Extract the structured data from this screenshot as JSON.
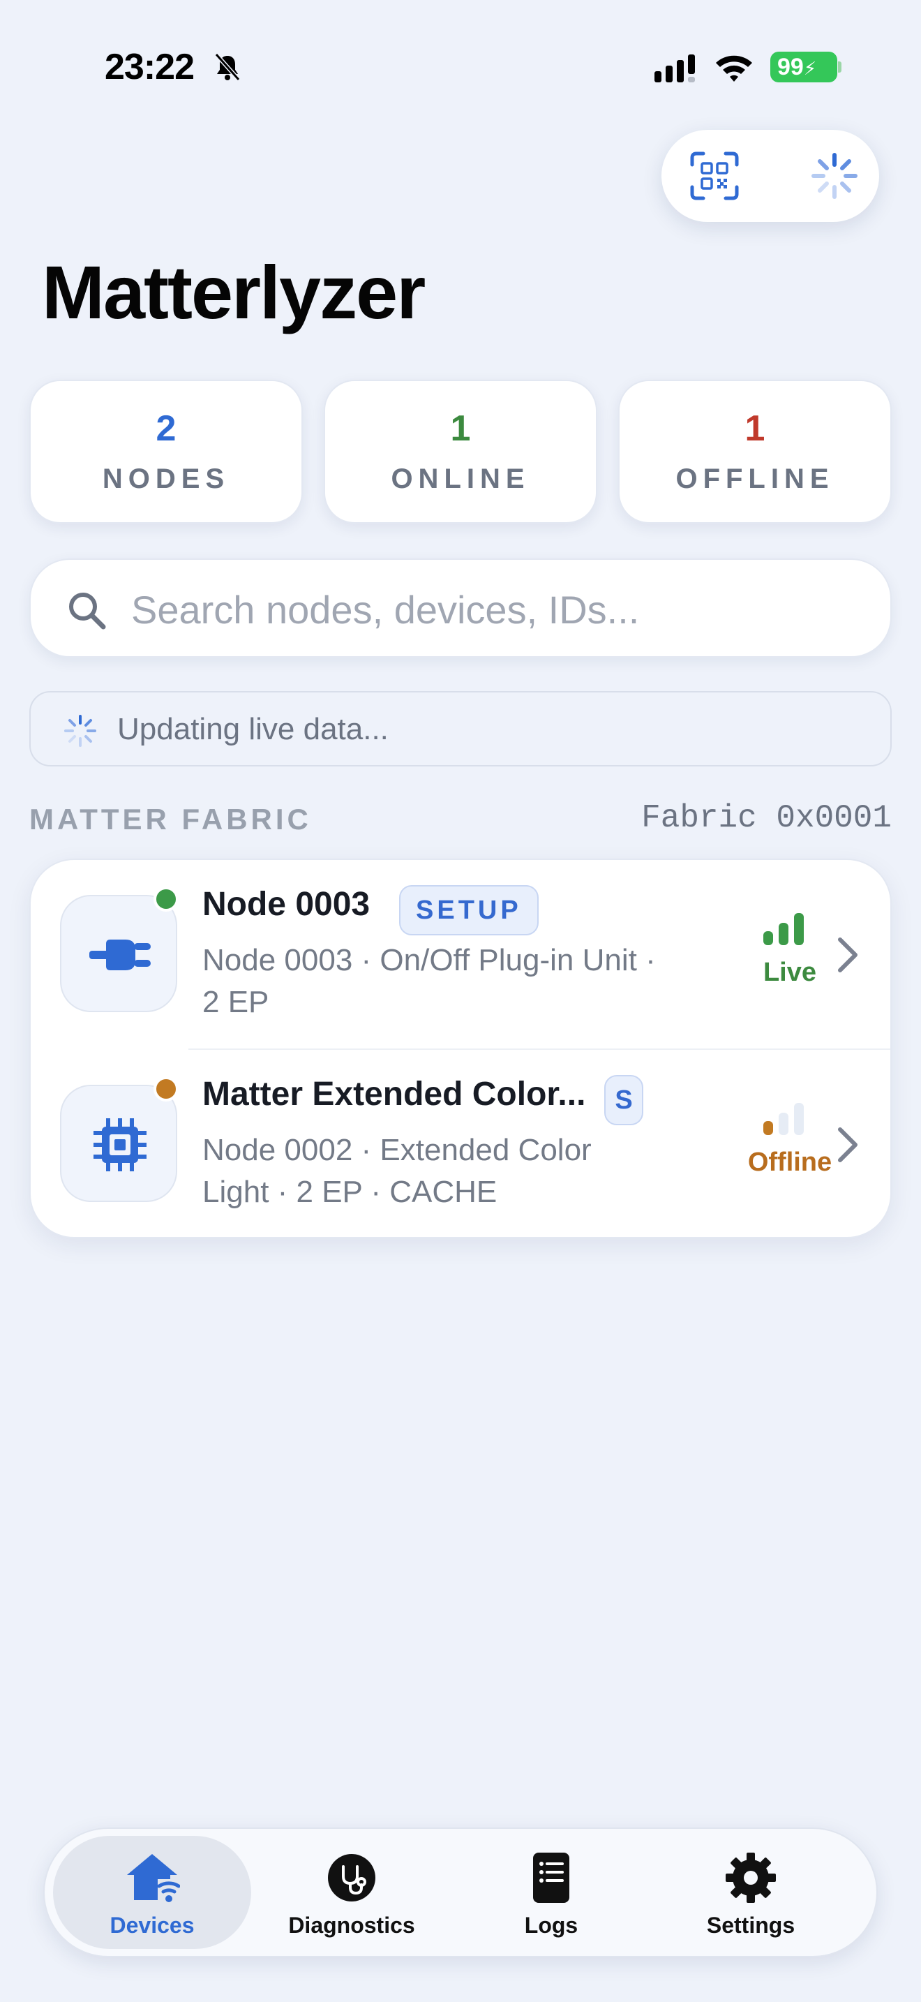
{
  "status_bar": {
    "time": "23:22",
    "battery": "99"
  },
  "header": {
    "title": "Matterlyzer"
  },
  "stats": [
    {
      "value": "2",
      "label": "NODES",
      "color": "#2f6ad3"
    },
    {
      "value": "1",
      "label": "ONLINE",
      "color": "#3c8a3f"
    },
    {
      "value": "1",
      "label": "OFFLINE",
      "color": "#c0392b"
    }
  ],
  "search": {
    "placeholder": "Search nodes, devices, IDs..."
  },
  "live_banner": {
    "text": "Updating live data..."
  },
  "section": {
    "label": "MATTER FABRIC",
    "fabric_id": "Fabric 0x0001"
  },
  "devices": [
    {
      "title": "Node 0003",
      "badge": "SETUP",
      "subtitle": "Node 0003  ·  On/Off Plug-in Unit  ·  2 EP",
      "status": "Live",
      "status_color": "#3c8a3f",
      "icon": "plug-icon",
      "online": true
    },
    {
      "title": "Matter Extended Color...",
      "badge": "S",
      "subtitle": "Node 0002  ·  Extended Color Light  ·  2 EP  ·  CACHE",
      "status": "Offline",
      "status_color": "#b86d1e",
      "icon": "chip-icon",
      "online": false
    }
  ],
  "tabs": [
    {
      "label": "Devices",
      "icon": "home-wifi-icon",
      "active": true
    },
    {
      "label": "Diagnostics",
      "icon": "stethoscope-icon",
      "active": false
    },
    {
      "label": "Logs",
      "icon": "list-icon",
      "active": false
    },
    {
      "label": "Settings",
      "icon": "gear-icon",
      "active": false
    }
  ],
  "colors": {
    "accent": "#2f6ad3",
    "background": "#eef2fa"
  }
}
